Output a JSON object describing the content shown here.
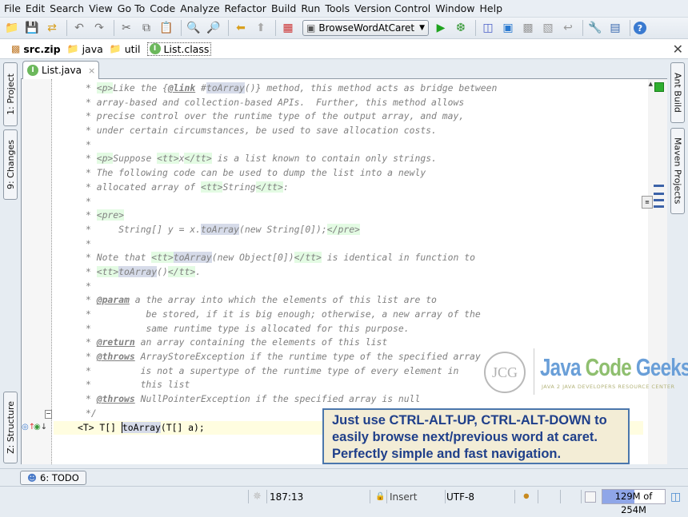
{
  "menu": [
    "File",
    "Edit",
    "Search",
    "View",
    "Go To",
    "Code",
    "Analyze",
    "Refactor",
    "Build",
    "Run",
    "Tools",
    "Version Control",
    "Window",
    "Help"
  ],
  "toolbar": {
    "run_config": "BrowseWordAtCaret",
    "icons": [
      "open-folder-icon",
      "save-icon",
      "sync-icon",
      "undo-icon",
      "redo-icon",
      "cut-icon",
      "copy-icon",
      "paste-icon",
      "find-icon",
      "find-usages-icon",
      "back-icon",
      "forward-icon",
      "structure-icon"
    ],
    "icons_right": [
      "run-icon",
      "debug-icon",
      "make-icon",
      "deploy-icon",
      "vcs-icon",
      "vcs-commit-icon",
      "revert-icon",
      "settings-icon",
      "project-structure-icon",
      "help-icon"
    ]
  },
  "breadcrumbs": [
    {
      "label": "src.zip",
      "icon": "archive-icon",
      "bold": true
    },
    {
      "label": "java",
      "icon": "folder-icon"
    },
    {
      "label": "util",
      "icon": "folder-icon"
    },
    {
      "label": "List.class",
      "icon": "interface-icon",
      "selected": true
    }
  ],
  "left_tool_tabs": [
    "1: Project",
    "9: Changes",
    "Z: Structure"
  ],
  "right_tool_tabs": [
    "Ant Build",
    "Maven Projects"
  ],
  "editor_tab": {
    "label": "List.java",
    "close": "×"
  },
  "code_lines": [
    [
      [
        "* ",
        ""
      ],
      [
        "<p>",
        "tag"
      ],
      [
        "Like the {",
        ""
      ],
      [
        "@link",
        "kw"
      ],
      [
        " #",
        ""
      ],
      [
        "toArray",
        "ref"
      ],
      [
        "()} method, this method acts as bridge between",
        ""
      ]
    ],
    [
      [
        "* array-based and collection-based APIs.  Further, this method allows",
        ""
      ]
    ],
    [
      [
        "* precise control over the runtime type of the output array, and may,",
        ""
      ]
    ],
    [
      [
        "* under certain circumstances, be used to save allocation costs.",
        ""
      ]
    ],
    [
      [
        "*",
        ""
      ]
    ],
    [
      [
        "* ",
        ""
      ],
      [
        "<p>",
        "tag"
      ],
      [
        "Suppose ",
        ""
      ],
      [
        "<tt>",
        "tag"
      ],
      [
        "x",
        ""
      ],
      [
        "</tt>",
        "tag"
      ],
      [
        " is a list known to contain only strings.",
        ""
      ]
    ],
    [
      [
        "* The following code can be used to dump the list into a newly",
        ""
      ]
    ],
    [
      [
        "* allocated array of ",
        ""
      ],
      [
        "<tt>",
        "tag"
      ],
      [
        "String",
        ""
      ],
      [
        "</tt>",
        "tag"
      ],
      [
        ":",
        ""
      ]
    ],
    [
      [
        "*",
        ""
      ]
    ],
    [
      [
        "* ",
        ""
      ],
      [
        "<pre>",
        "tag"
      ]
    ],
    [
      [
        "*     String[] y = x.",
        ""
      ],
      [
        "toArray",
        "ref"
      ],
      [
        "(new String[0]);",
        ""
      ],
      [
        "</pre>",
        "tag"
      ]
    ],
    [
      [
        "*",
        ""
      ]
    ],
    [
      [
        "* Note that ",
        ""
      ],
      [
        "<tt>",
        "tag"
      ],
      [
        "toArray",
        "ref"
      ],
      [
        "(new Object[0])",
        ""
      ],
      [
        "</tt>",
        "tag"
      ],
      [
        " is identical in function to",
        ""
      ]
    ],
    [
      [
        "* ",
        ""
      ],
      [
        "<tt>",
        "tag"
      ],
      [
        "toArray",
        "ref"
      ],
      [
        "()",
        ""
      ],
      [
        "</tt>",
        "tag"
      ],
      [
        ".",
        ""
      ]
    ],
    [
      [
        "*",
        ""
      ]
    ],
    [
      [
        "* ",
        ""
      ],
      [
        "@param",
        "kw"
      ],
      [
        " a the array into which the elements of this list are to",
        ""
      ]
    ],
    [
      [
        "*          be stored, if it is big enough; otherwise, a new array of the",
        ""
      ]
    ],
    [
      [
        "*          same runtime type is allocated for this purpose.",
        ""
      ]
    ],
    [
      [
        "* ",
        ""
      ],
      [
        "@return",
        "kw"
      ],
      [
        " an array containing the elements of this list",
        ""
      ]
    ],
    [
      [
        "* ",
        ""
      ],
      [
        "@throws",
        "kw"
      ],
      [
        " ArrayStoreException if the runtime type of the specified array",
        ""
      ]
    ],
    [
      [
        "*         is not a supertype of the runtime type of every element in",
        ""
      ]
    ],
    [
      [
        "*         this list",
        ""
      ]
    ],
    [
      [
        "* ",
        ""
      ],
      [
        "@throws",
        "kw"
      ],
      [
        " NullPointerException if the specified array is null",
        ""
      ]
    ],
    [
      [
        "*/",
        ""
      ]
    ]
  ],
  "caret_line": {
    "prefix": "<T> T[] ",
    "method": "toArray",
    "suffix": "(T[] a);"
  },
  "tip": {
    "line1": "Just use CTRL-ALT-UP, CTRL-ALT-DOWN to",
    "line2": "easily browse next/previous word at caret.",
    "line3": "Perfectly simple and fast navigation."
  },
  "logo": {
    "circle": "JCG",
    "title_a": "Java ",
    "title_b": "Code ",
    "title_c": "Geeks",
    "subtitle": "JAVA 2 JAVA DEVELOPERS RESOURCE CENTER"
  },
  "bottom_tab": {
    "label": "6: TODO"
  },
  "status": {
    "position": "187:13",
    "mode": "Insert",
    "encoding": "UTF-8",
    "memory_used": "129M",
    "memory_total": "254M",
    "memory_label": "129M of 254M",
    "memory_fraction": 0.508
  }
}
